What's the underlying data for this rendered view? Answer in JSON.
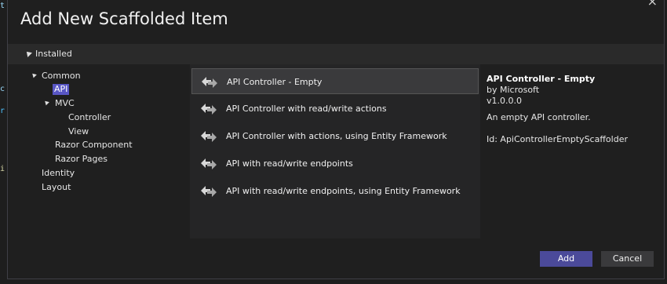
{
  "dialog": {
    "title": "Add New Scaffolded Item",
    "close_glyph": "×"
  },
  "tree": {
    "root": "Installed",
    "nodes": [
      {
        "label": "Common"
      },
      {
        "label": "API",
        "selected": true
      },
      {
        "label": "MVC"
      },
      {
        "label": "Controller"
      },
      {
        "label": "View"
      },
      {
        "label": "Razor Component"
      },
      {
        "label": "Razor Pages"
      },
      {
        "label": "Identity"
      },
      {
        "label": "Layout"
      }
    ]
  },
  "templates": [
    {
      "label": "API Controller - Empty",
      "selected": true,
      "icon": "scaffold-icon"
    },
    {
      "label": "API Controller with read/write actions",
      "icon": "scaffold-icon"
    },
    {
      "label": "API Controller with actions, using Entity Framework",
      "icon": "scaffold-icon"
    },
    {
      "label": "API with read/write endpoints",
      "icon": "scaffold-icon"
    },
    {
      "label": "API with read/write endpoints, using Entity Framework",
      "icon": "scaffold-icon"
    }
  ],
  "details": {
    "title": "API Controller - Empty",
    "author": "by Microsoft",
    "version": "v1.0.0.0",
    "description": "An empty API controller.",
    "id": "Id: ApiControllerEmptyScaffolder"
  },
  "buttons": {
    "add": "Add",
    "cancel": "Cancel"
  },
  "colors": {
    "selection": "#5856c4",
    "primary_button": "#4b4a9a",
    "background": "#1f1f1f"
  }
}
